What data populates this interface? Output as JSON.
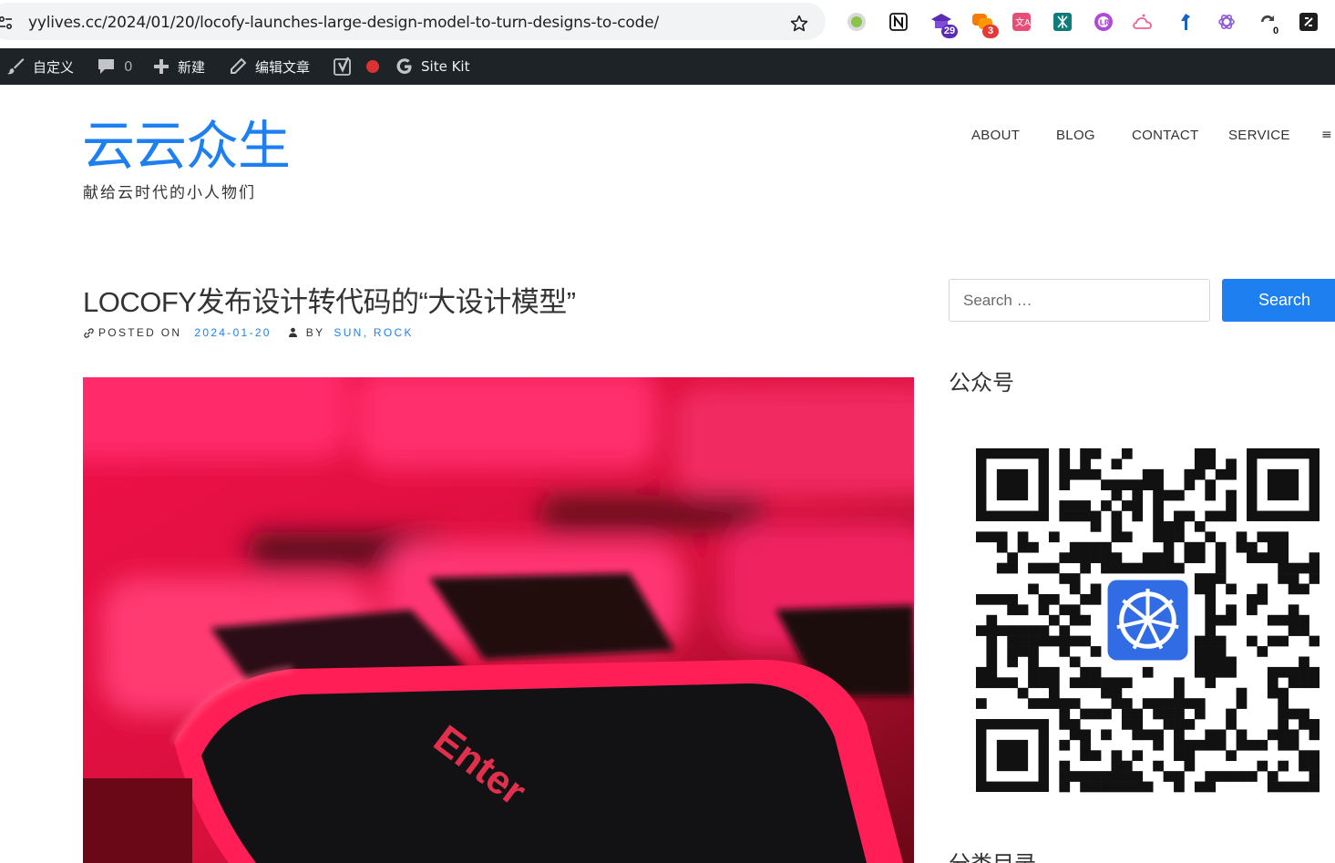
{
  "browser": {
    "url": "yylives.cc/2024/01/20/locofy-launches-large-design-model-to-turn-designs-to-code/",
    "extensions": [
      {
        "name": "status-dot-extension",
        "badge": ""
      },
      {
        "name": "notion-extension",
        "badge": ""
      },
      {
        "name": "school-extension",
        "badge": "29",
        "badge_color": "#5b2bb5"
      },
      {
        "name": "chat-extension",
        "badge": "3",
        "badge_color": "#e53935"
      },
      {
        "name": "translate-extension",
        "badge": ""
      },
      {
        "name": "mind-extension",
        "badge": ""
      },
      {
        "name": "lr-extension",
        "badge": ""
      },
      {
        "name": "cloud-extension",
        "badge": ""
      },
      {
        "name": "arrow-extension",
        "badge": ""
      },
      {
        "name": "openai-extension",
        "badge": ""
      },
      {
        "name": "sync-extension",
        "badge": "0",
        "badge_color": "#444444"
      },
      {
        "name": "dark-extension",
        "badge": ""
      }
    ]
  },
  "adminbar": {
    "customize": "自定义",
    "comments_count": "0",
    "new": "新建",
    "edit": "编辑文章",
    "site_kit": "Site Kit"
  },
  "site": {
    "title": "云云众生",
    "description": "献给云时代的小人物们"
  },
  "nav": {
    "items": [
      "ABOUT",
      "BLOG",
      "CONTACT",
      "SERVICE"
    ],
    "toggle": "≡"
  },
  "post": {
    "title": "LOCOFY发布设计转代码的“大设计模型”",
    "posted_on_label": "POSTED ON",
    "date": "2024-01-20",
    "by_label": "BY",
    "author": "SUN, ROCK"
  },
  "sidebar": {
    "search_placeholder": "Search …",
    "search_button": "Search",
    "wechat_title": "公众号",
    "categories_title": "分类目录"
  },
  "colors": {
    "accent": "#1e7ff0",
    "adminbar": "#1d2327"
  }
}
